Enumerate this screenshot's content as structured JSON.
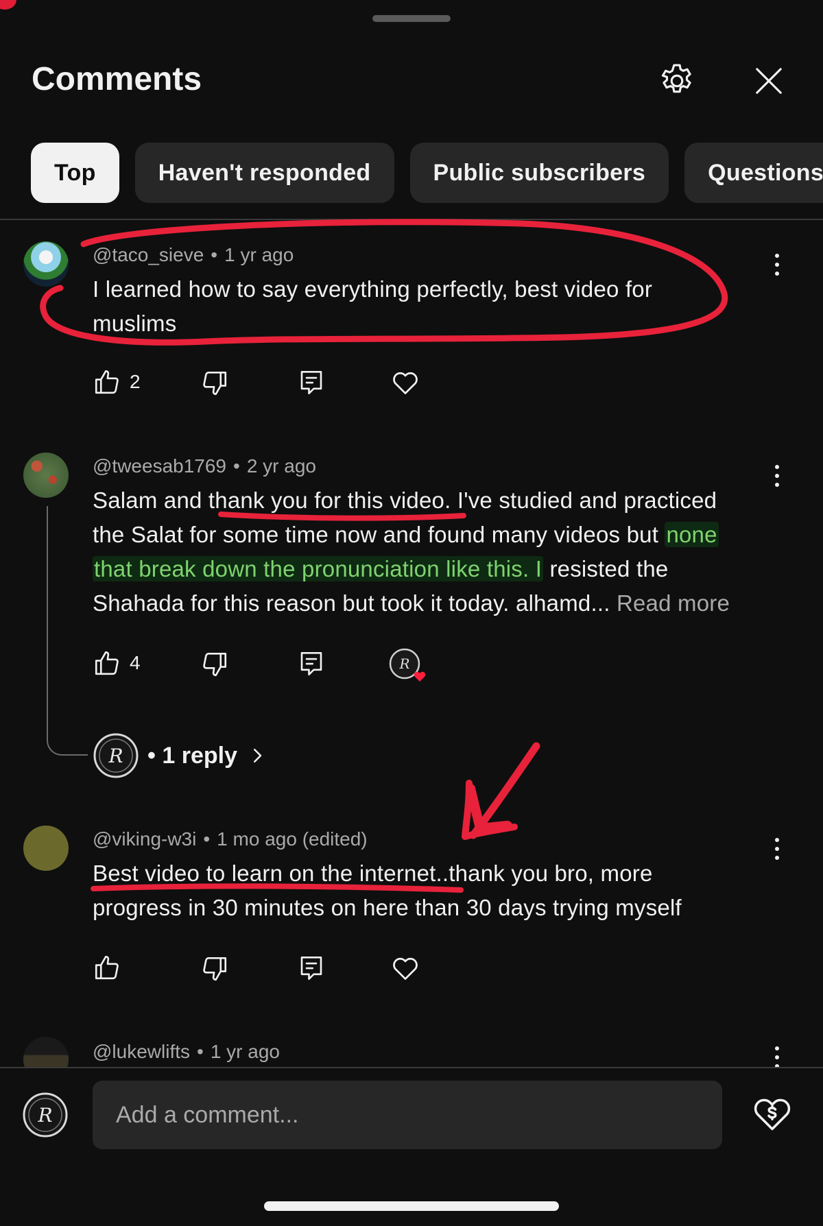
{
  "header": {
    "title": "Comments"
  },
  "filters": [
    {
      "label": "Top",
      "active": true
    },
    {
      "label": "Haven't responded",
      "active": false
    },
    {
      "label": "Public subscribers",
      "active": false
    },
    {
      "label": "Questions",
      "active": false
    }
  ],
  "comments": [
    {
      "author": "@taco_sieve",
      "sep": "•",
      "time": "1 yr ago",
      "line1": "I learned how to say everything perfectly, best video for",
      "line2": "muslims",
      "likes": "2"
    },
    {
      "author": "@tweesab1769",
      "sep": "•",
      "time": "2 yr ago",
      "line1": "Salam and thank you for this video. I've studied and practiced",
      "line2a": "the Salat for some time now and found many videos but ",
      "line2b": "none",
      "line3a": "that break down the pronunciation like this. I",
      "line3b": " resisted the",
      "line4": "Shahada for this reason but took it today. alhamd...",
      "read_more": "Read more",
      "likes": "4",
      "replies": {
        "sep": "•",
        "label": "1 reply"
      }
    },
    {
      "author": "@viking-w3i",
      "sep": "•",
      "time": "1 mo ago (edited)",
      "line1": "Best video to learn on the internet..thank you bro, more",
      "line2": "progress in 30 minutes on here than 30 days trying myself"
    },
    {
      "author": "@lukewlifts",
      "sep": "•",
      "time": "1 yr ago"
    }
  ],
  "composer": {
    "placeholder": "Add a comment..."
  },
  "colors": {
    "background": "#0f0f0f",
    "chip": "#272727",
    "annotation": "#e8223a",
    "highlight_text": "#7fd36f"
  },
  "icons": [
    "settings-gear-icon",
    "close-icon",
    "like-icon",
    "dislike-icon",
    "reply-icon",
    "heart-icon",
    "kebab-menu-icon",
    "chevron-right-icon",
    "super-thanks-icon"
  ]
}
